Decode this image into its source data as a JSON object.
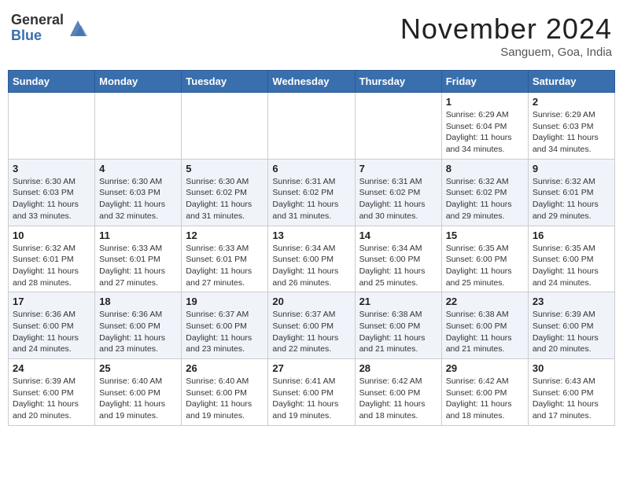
{
  "header": {
    "logo_general": "General",
    "logo_blue": "Blue",
    "month_title": "November 2024",
    "location": "Sanguem, Goa, India"
  },
  "days_of_week": [
    "Sunday",
    "Monday",
    "Tuesday",
    "Wednesday",
    "Thursday",
    "Friday",
    "Saturday"
  ],
  "weeks": [
    [
      {
        "day": "",
        "info": ""
      },
      {
        "day": "",
        "info": ""
      },
      {
        "day": "",
        "info": ""
      },
      {
        "day": "",
        "info": ""
      },
      {
        "day": "",
        "info": ""
      },
      {
        "day": "1",
        "info": "Sunrise: 6:29 AM\nSunset: 6:04 PM\nDaylight: 11 hours\nand 34 minutes."
      },
      {
        "day": "2",
        "info": "Sunrise: 6:29 AM\nSunset: 6:03 PM\nDaylight: 11 hours\nand 34 minutes."
      }
    ],
    [
      {
        "day": "3",
        "info": "Sunrise: 6:30 AM\nSunset: 6:03 PM\nDaylight: 11 hours\nand 33 minutes."
      },
      {
        "day": "4",
        "info": "Sunrise: 6:30 AM\nSunset: 6:03 PM\nDaylight: 11 hours\nand 32 minutes."
      },
      {
        "day": "5",
        "info": "Sunrise: 6:30 AM\nSunset: 6:02 PM\nDaylight: 11 hours\nand 31 minutes."
      },
      {
        "day": "6",
        "info": "Sunrise: 6:31 AM\nSunset: 6:02 PM\nDaylight: 11 hours\nand 31 minutes."
      },
      {
        "day": "7",
        "info": "Sunrise: 6:31 AM\nSunset: 6:02 PM\nDaylight: 11 hours\nand 30 minutes."
      },
      {
        "day": "8",
        "info": "Sunrise: 6:32 AM\nSunset: 6:02 PM\nDaylight: 11 hours\nand 29 minutes."
      },
      {
        "day": "9",
        "info": "Sunrise: 6:32 AM\nSunset: 6:01 PM\nDaylight: 11 hours\nand 29 minutes."
      }
    ],
    [
      {
        "day": "10",
        "info": "Sunrise: 6:32 AM\nSunset: 6:01 PM\nDaylight: 11 hours\nand 28 minutes."
      },
      {
        "day": "11",
        "info": "Sunrise: 6:33 AM\nSunset: 6:01 PM\nDaylight: 11 hours\nand 27 minutes."
      },
      {
        "day": "12",
        "info": "Sunrise: 6:33 AM\nSunset: 6:01 PM\nDaylight: 11 hours\nand 27 minutes."
      },
      {
        "day": "13",
        "info": "Sunrise: 6:34 AM\nSunset: 6:00 PM\nDaylight: 11 hours\nand 26 minutes."
      },
      {
        "day": "14",
        "info": "Sunrise: 6:34 AM\nSunset: 6:00 PM\nDaylight: 11 hours\nand 25 minutes."
      },
      {
        "day": "15",
        "info": "Sunrise: 6:35 AM\nSunset: 6:00 PM\nDaylight: 11 hours\nand 25 minutes."
      },
      {
        "day": "16",
        "info": "Sunrise: 6:35 AM\nSunset: 6:00 PM\nDaylight: 11 hours\nand 24 minutes."
      }
    ],
    [
      {
        "day": "17",
        "info": "Sunrise: 6:36 AM\nSunset: 6:00 PM\nDaylight: 11 hours\nand 24 minutes."
      },
      {
        "day": "18",
        "info": "Sunrise: 6:36 AM\nSunset: 6:00 PM\nDaylight: 11 hours\nand 23 minutes."
      },
      {
        "day": "19",
        "info": "Sunrise: 6:37 AM\nSunset: 6:00 PM\nDaylight: 11 hours\nand 23 minutes."
      },
      {
        "day": "20",
        "info": "Sunrise: 6:37 AM\nSunset: 6:00 PM\nDaylight: 11 hours\nand 22 minutes."
      },
      {
        "day": "21",
        "info": "Sunrise: 6:38 AM\nSunset: 6:00 PM\nDaylight: 11 hours\nand 21 minutes."
      },
      {
        "day": "22",
        "info": "Sunrise: 6:38 AM\nSunset: 6:00 PM\nDaylight: 11 hours\nand 21 minutes."
      },
      {
        "day": "23",
        "info": "Sunrise: 6:39 AM\nSunset: 6:00 PM\nDaylight: 11 hours\nand 20 minutes."
      }
    ],
    [
      {
        "day": "24",
        "info": "Sunrise: 6:39 AM\nSunset: 6:00 PM\nDaylight: 11 hours\nand 20 minutes."
      },
      {
        "day": "25",
        "info": "Sunrise: 6:40 AM\nSunset: 6:00 PM\nDaylight: 11 hours\nand 19 minutes."
      },
      {
        "day": "26",
        "info": "Sunrise: 6:40 AM\nSunset: 6:00 PM\nDaylight: 11 hours\nand 19 minutes."
      },
      {
        "day": "27",
        "info": "Sunrise: 6:41 AM\nSunset: 6:00 PM\nDaylight: 11 hours\nand 19 minutes."
      },
      {
        "day": "28",
        "info": "Sunrise: 6:42 AM\nSunset: 6:00 PM\nDaylight: 11 hours\nand 18 minutes."
      },
      {
        "day": "29",
        "info": "Sunrise: 6:42 AM\nSunset: 6:00 PM\nDaylight: 11 hours\nand 18 minutes."
      },
      {
        "day": "30",
        "info": "Sunrise: 6:43 AM\nSunset: 6:00 PM\nDaylight: 11 hours\nand 17 minutes."
      }
    ]
  ]
}
